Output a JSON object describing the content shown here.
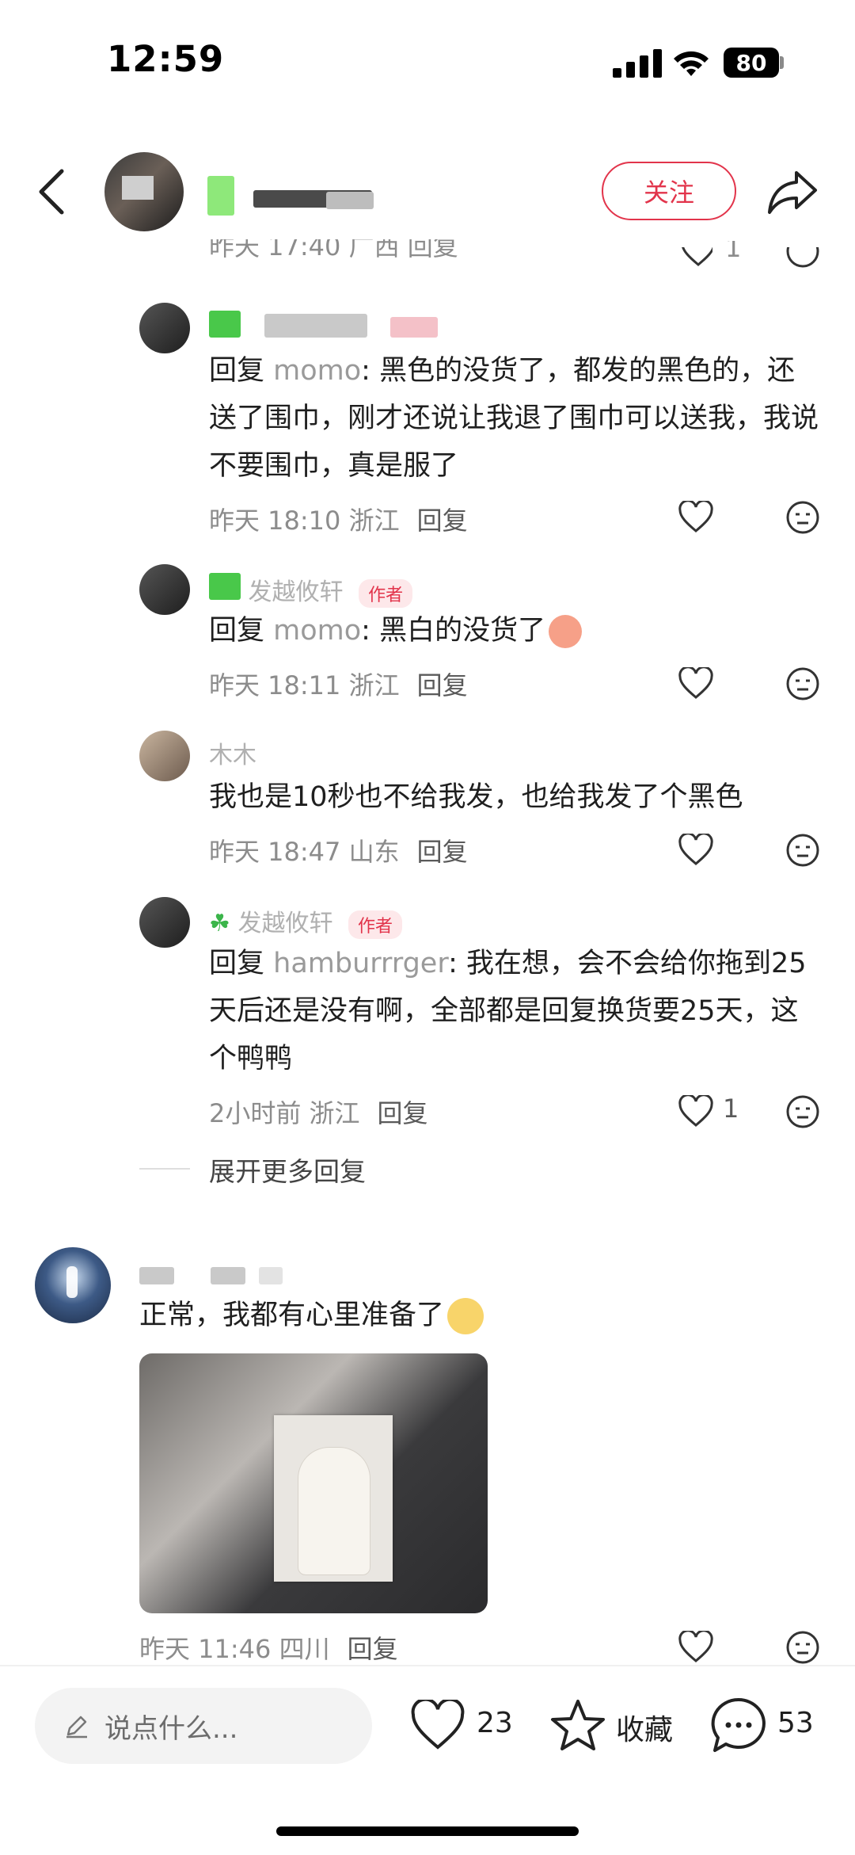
{
  "status_bar": {
    "time": "12:59",
    "battery": "80"
  },
  "header": {
    "follow_label": "关注"
  },
  "partial_top_meta": "昨天 17:40 广西   回复",
  "partial_top_like": "1",
  "replies": [
    {
      "username": "",
      "author_badge": "",
      "reply_prefix": "回复 ",
      "mention": "momo",
      "text": ": 黑色的没货了，都发的黑色的，还送了围巾，刚才还说让我退了围巾可以送我，我说不要围巾，真是服了",
      "date": "昨天 18:10 浙江",
      "reply_label": "回复",
      "likes": ""
    },
    {
      "username": "发越攸轩",
      "author_badge": "作者",
      "reply_prefix": "回复 ",
      "mention": "momo",
      "text": ": 黑白的没货了",
      "date": "昨天 18:11 浙江",
      "reply_label": "回复",
      "likes": ""
    },
    {
      "username": "木木",
      "author_badge": "",
      "reply_prefix": "",
      "mention": "",
      "text": "我也是10秒也不给我发，也给我发了个黑色",
      "date": "昨天 18:47 山东",
      "reply_label": "回复",
      "likes": ""
    },
    {
      "username": "发越攸轩",
      "author_badge": "作者",
      "reply_prefix": "回复 ",
      "mention": "hamburrrger",
      "text": ": 我在想，会不会给你拖到25天后还是没有啊，全部都是回复换货要25天，这个鸭鸭",
      "date": "2小时前 浙江",
      "reply_label": "回复",
      "likes": "1"
    }
  ],
  "expand_more": "展开更多回复",
  "top_comment": {
    "text": "正常，我都有心里准备了",
    "date": "昨天 11:46 四川",
    "reply_label": "回复"
  },
  "bottom_bar": {
    "input_placeholder": "说点什么...",
    "like_count": "23",
    "collect_label": "收藏",
    "comment_count": "53"
  },
  "colors": {
    "accent": "#e2344b",
    "muted_text": "#8c8c8c"
  },
  "icons": [
    "back-icon",
    "share-icon",
    "heart-icon",
    "dislike-icon",
    "pencil-icon",
    "star-icon",
    "chat-icon",
    "signal-icon",
    "wifi-icon"
  ]
}
